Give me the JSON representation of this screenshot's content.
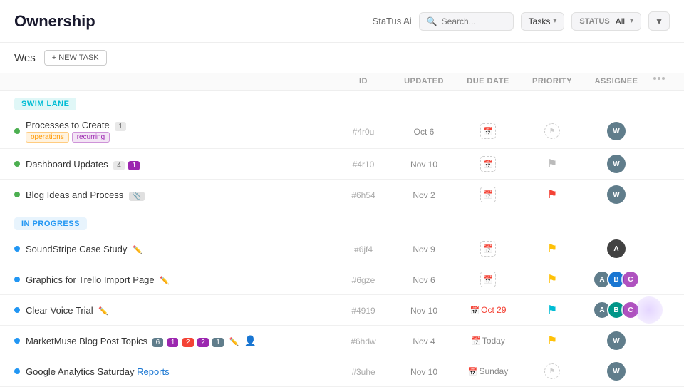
{
  "header": {
    "title": "Ownership",
    "search_placeholder": "Search...",
    "tasks_label": "Tasks",
    "status_prefix": "STATUS",
    "status_value": "All",
    "logo": "StaTus Ai"
  },
  "subheader": {
    "user": "Wes",
    "new_task_btn": "+ NEW TASK"
  },
  "table": {
    "columns": [
      "",
      "ID",
      "UPDATED",
      "DUE DATE",
      "PRIORITY",
      "ASSIGNEE",
      ""
    ],
    "sections": [
      {
        "label": "SWIM LANE",
        "type": "swim-lane",
        "rows": [
          {
            "name": "Processes to Create",
            "badge_count": "1",
            "tags": [
              "operations",
              "recurring"
            ],
            "id": "#4r0u",
            "updated": "Oct 6",
            "due_date": "",
            "priority": "none",
            "assignee_color": "#607d8b",
            "has_cal_icon": false,
            "due_overdue": false
          },
          {
            "name": "Dashboard Updates",
            "badge_count": "4",
            "badge_extra": "1",
            "tags": [],
            "id": "#4r10",
            "updated": "Nov 10",
            "due_date": "",
            "priority": "flag-gray",
            "assignee_color": "#607d8b",
            "has_cal_icon": false,
            "due_overdue": false
          },
          {
            "name": "Blog Ideas and Process",
            "tags": [],
            "id": "#6h54",
            "updated": "Nov 2",
            "due_date": "",
            "priority": "flag-red",
            "assignee_color": "#607d8b",
            "has_cal_icon": false,
            "due_overdue": false
          }
        ]
      },
      {
        "label": "IN PROGRESS",
        "type": "in-progress",
        "rows": [
          {
            "name": "SoundStripe Case Study",
            "tags": [],
            "id": "#6jf4",
            "updated": "Nov 9",
            "due_date": "",
            "priority": "flag-yellow",
            "assignee_color": "#424242",
            "has_cal_icon": false,
            "due_overdue": false,
            "edit_icon": true
          },
          {
            "name": "Graphics for Trello Import Page",
            "tags": [],
            "id": "#6gze",
            "updated": "Nov 6",
            "due_date": "",
            "priority": "flag-yellow",
            "assignee_multi": true,
            "has_cal_icon": false,
            "due_overdue": false,
            "edit_icon": true
          },
          {
            "name": "Clear Voice Trial",
            "tags": [],
            "id": "#4919",
            "updated": "Nov 10",
            "due_date": "Oct 29",
            "priority": "flag-cyan",
            "assignee_multi2": true,
            "has_cal_icon": true,
            "due_overdue": true,
            "edit_icon": true
          },
          {
            "name": "MarketMuse Blog Post Topics",
            "tags": [],
            "id": "#6hdw",
            "updated": "Nov 4",
            "due_date": "Today",
            "priority": "flag-yellow",
            "assignee_color": "#607d8b",
            "has_cal_icon": true,
            "due_overdue": false,
            "edit_icon": true,
            "has_badges": true,
            "has_person_icon": true
          },
          {
            "name": "Google Analytics Saturday Reports",
            "tags": [],
            "id": "#3uhe",
            "updated": "Nov 10",
            "due_date": "Sunday",
            "priority": "none-circle",
            "assignee_color": "#607d8b",
            "has_cal_icon": true,
            "due_overdue": false
          }
        ]
      }
    ]
  }
}
